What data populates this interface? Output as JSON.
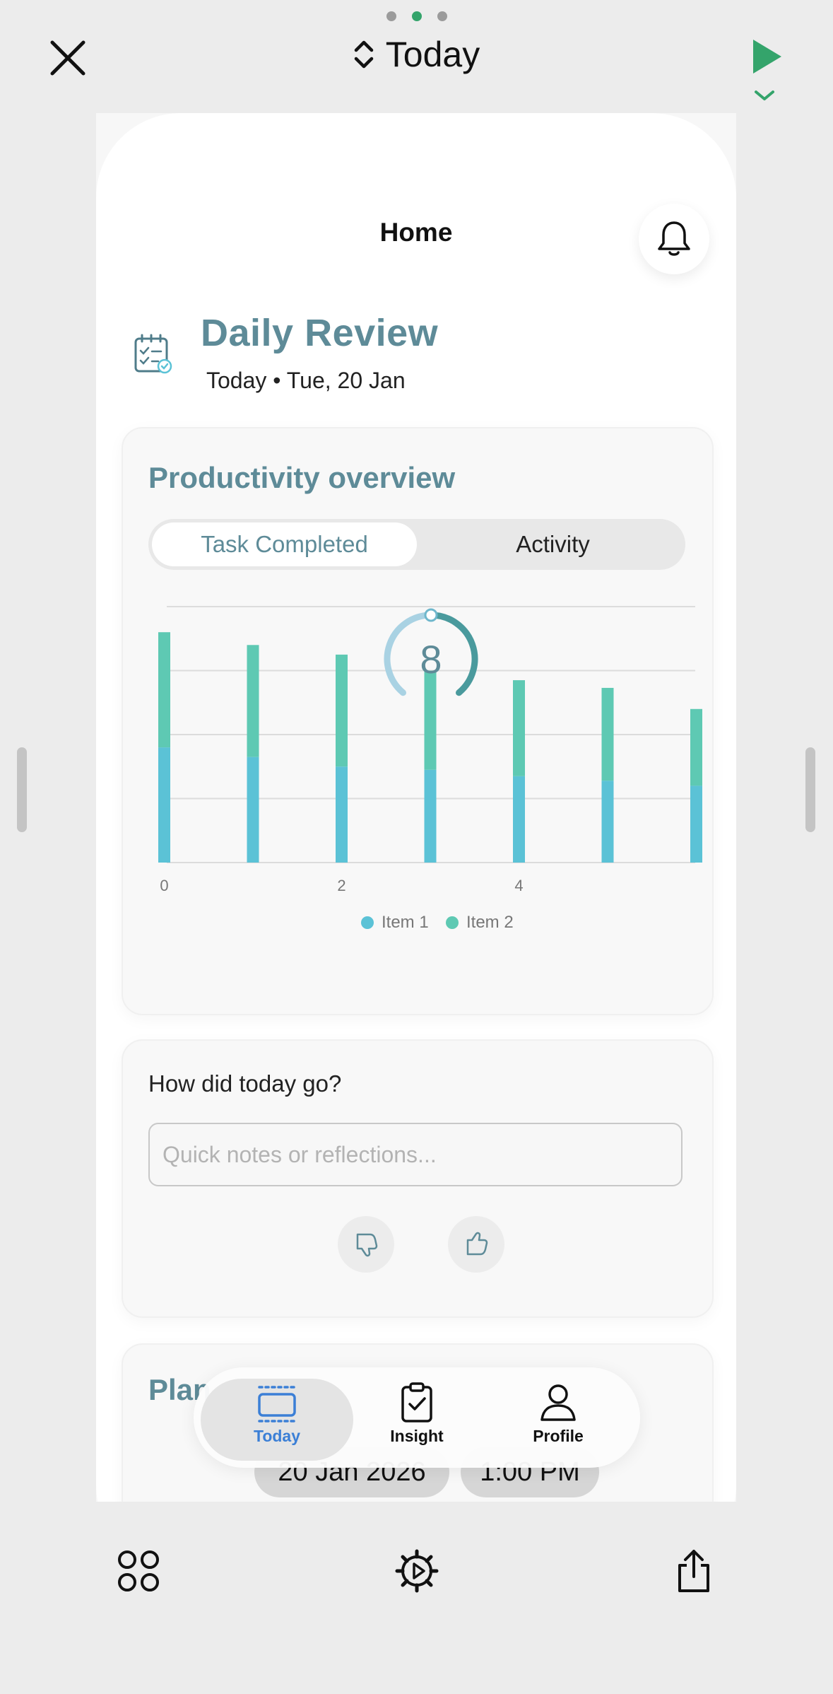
{
  "window": {
    "title": "Today"
  },
  "app": {
    "home_title": "Home",
    "review": {
      "title": "Daily Review",
      "subtitle": "Today • Tue, 20 Jan"
    },
    "productivity": {
      "title": "Productivity overview",
      "tabs": [
        {
          "label": "Task Completed",
          "selected": true
        },
        {
          "label": "Activity",
          "selected": false
        }
      ],
      "timer_value": "8"
    },
    "reflection": {
      "question": "How did today go?",
      "placeholder": "Quick notes or reflections..."
    },
    "plan": {
      "title": "Plan",
      "date": "20 Jan 2026",
      "time": "1:00 PM"
    },
    "nav": {
      "today": "Today",
      "insight": "Insight",
      "profile": "Profile"
    }
  },
  "chart_data": {
    "type": "bar",
    "stacked": true,
    "x": [
      0,
      1,
      2,
      3,
      4,
      5,
      6
    ],
    "x_tick_labels": [
      "0",
      "2",
      "4"
    ],
    "series": [
      {
        "name": "Item 1",
        "color": "#5bc2d6",
        "values": [
          1.8,
          1.65,
          1.5,
          1.45,
          1.35,
          1.28,
          1.2
        ]
      },
      {
        "name": "Item 2",
        "color": "#5ec9b3",
        "values": [
          1.8,
          1.75,
          1.75,
          1.55,
          1.5,
          1.45,
          1.2
        ]
      }
    ],
    "ylim": [
      0,
      4
    ],
    "grid": true,
    "legend": "bottom-center",
    "xlabel": "",
    "ylabel": ""
  }
}
